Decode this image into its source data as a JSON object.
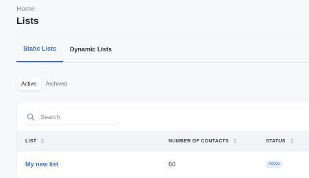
{
  "breadcrumb": "Home",
  "page_title": "Lists",
  "tabs": [
    {
      "label": "Static Lists",
      "active": true
    },
    {
      "label": "Dynamic Lists",
      "active": false
    }
  ],
  "segments": [
    {
      "label": "Active",
      "active": true
    },
    {
      "label": "Archived",
      "active": false
    }
  ],
  "search": {
    "placeholder": "Search",
    "value": ""
  },
  "table": {
    "columns": [
      {
        "label": "LIST"
      },
      {
        "label": "NUMBER OF CONTACTS"
      },
      {
        "label": "STATUS"
      }
    ],
    "rows": [
      {
        "name": "My new list",
        "contacts": "60",
        "status": "Active"
      }
    ]
  },
  "colors": {
    "accent": "#3b6fd9",
    "badge_bg": "#e4edfb",
    "header_bg": "#f2f4f8"
  },
  "icons": {
    "search": "search-icon",
    "sort": "sort-icon"
  }
}
